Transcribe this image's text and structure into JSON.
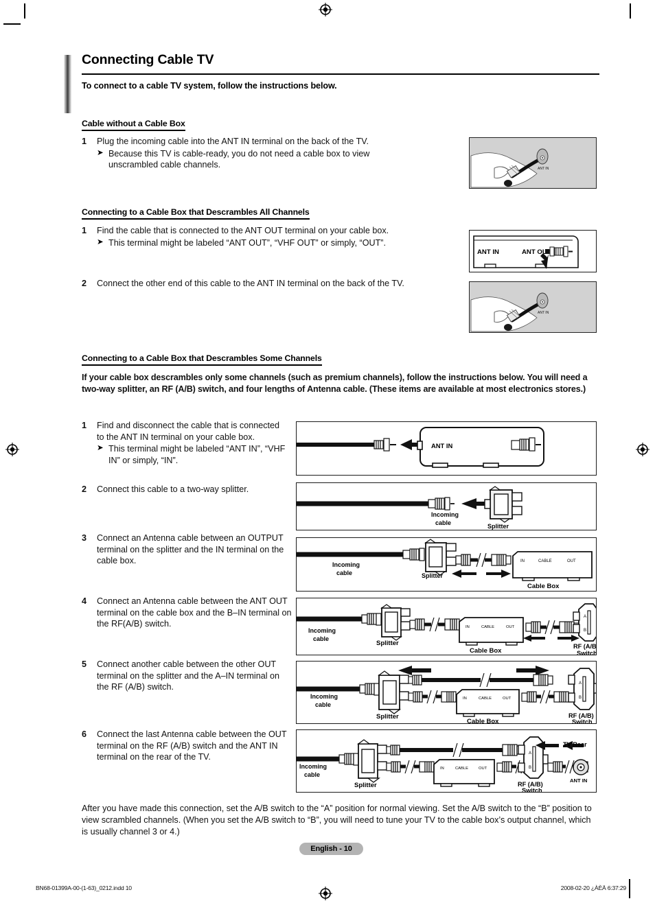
{
  "document": {
    "title": "Connecting Cable TV",
    "subtitle": "To connect to a cable TV system, follow the instructions below.",
    "page_label": "English - 10",
    "footer_left": "BN68-01399A-00-(1-63)_0212.indd   10",
    "footer_right": "2008-02-20   ¿ÀÈÄ 6:37:29"
  },
  "sections": [
    {
      "heading": "Cable without a Cable Box",
      "steps": [
        {
          "num": "1",
          "text": "Plug the incoming cable into the ANT IN terminal on the back of the TV.",
          "sub": "Because this TV is cable-ready, you do not need a cable box to view unscrambled cable channels."
        }
      ]
    },
    {
      "heading": "Connecting to a Cable Box that Descrambles All Channels",
      "steps": [
        {
          "num": "1",
          "text": "Find the cable that is connected to the ANT OUT terminal on your cable box.",
          "sub": "This terminal might be labeled “ANT OUT”, “VHF OUT” or simply, “OUT”."
        },
        {
          "num": "2",
          "text": "Connect the other end of this cable to the ANT IN terminal on the back of the TV.",
          "sub": ""
        }
      ]
    },
    {
      "heading": "Connecting to a Cable Box that Descrambles Some Channels",
      "intro": "If your cable box descrambles only some channels (such as premium channels), follow the instructions below. You will need a two-way splitter, an RF (A/B) switch, and four lengths of Antenna cable. (These items are available at most electronics stores.)",
      "steps": [
        {
          "num": "1",
          "text": "Find and disconnect the cable that is connected to the ANT IN terminal on your cable box.",
          "sub": "This terminal might be labeled “ANT IN”, “VHF IN” or simply, “IN”."
        },
        {
          "num": "2",
          "text": "Connect this cable to a two-way splitter.",
          "sub": ""
        },
        {
          "num": "3",
          "text": "Connect an Antenna cable between an OUTPUT terminal on the splitter and the IN terminal on the cable box.",
          "sub": ""
        },
        {
          "num": "4",
          "text": "Connect an Antenna cable between the ANT OUT terminal on the cable box and the B–IN terminal on the RF(A/B) switch.",
          "sub": ""
        },
        {
          "num": "5",
          "text": "Connect another cable between the other OUT terminal on the splitter and the A–IN terminal on the RF (A/B) switch.",
          "sub": ""
        },
        {
          "num": "6",
          "text": "Connect the last Antenna cable between the OUT terminal on the RF (A/B) switch and the ANT IN terminal on the rear of the TV.",
          "sub": ""
        }
      ],
      "closing": "After you have made this connection, set the A/B switch to the “A” position for normal viewing. Set the A/B switch to the “B” position to view scrambled channels. (When you set the A/B switch to “B”, you will need to tune your TV to the cable box’s output channel, which is usually channel 3 or 4.)"
    }
  ],
  "illustrations": {
    "hand_ant_in_1": {
      "label": "ANT IN"
    },
    "cable_box_ant_out": {
      "label_in": "ANT IN",
      "label_out": "ANT OUT"
    },
    "hand_ant_in_2": {
      "label": "ANT IN"
    },
    "diagram1": {
      "ant_in": "ANT IN"
    },
    "diagram2": {
      "incoming": "Incoming\ncable",
      "incoming_l1": "Incoming",
      "incoming_l2": "cable",
      "splitter": "Splitter"
    },
    "diagram3": {
      "incoming_l1": "Incoming",
      "incoming_l2": "cable",
      "splitter": "Splitter",
      "box_in": "IN",
      "box_cable": "CABLE",
      "box_out": "OUT",
      "cable_box": "Cable Box"
    },
    "diagram4": {
      "incoming_l1": "Incoming",
      "incoming_l2": "cable",
      "splitter": "Splitter",
      "box_in": "IN",
      "box_cable": "CABLE",
      "box_out": "OUT",
      "cable_box": "Cable Box",
      "rf_l1": "RF (A/B)",
      "rf_l2": "Switch",
      "sw_a": "A",
      "sw_b": "B"
    },
    "diagram5": {
      "incoming_l1": "Incoming",
      "incoming_l2": "cable",
      "splitter": "Splitter",
      "box_in": "IN",
      "box_cable": "CABLE",
      "box_out": "OUT",
      "cable_box": "Cable Box",
      "rf_l1": "RF (A/B)",
      "rf_l2": "Switch",
      "sw_a": "A",
      "sw_b": "B"
    },
    "diagram6": {
      "incoming_l1": "Incoming",
      "incoming_l2": "cable",
      "splitter": "Splitter",
      "box_in": "IN",
      "box_cable": "CABLE",
      "box_out": "OUT",
      "rf_l1": "RF (A/B)",
      "rf_l2": "Switch",
      "sw_a": "A",
      "sw_b": "B",
      "tv_rear": "TV Rear",
      "ant_in": "ANT IN"
    }
  },
  "colors": {
    "accent_bar": "#3a3a3a",
    "page_pill": "#b3b3b3",
    "photo_bg": "#d2d2d2",
    "text": "#111111"
  }
}
